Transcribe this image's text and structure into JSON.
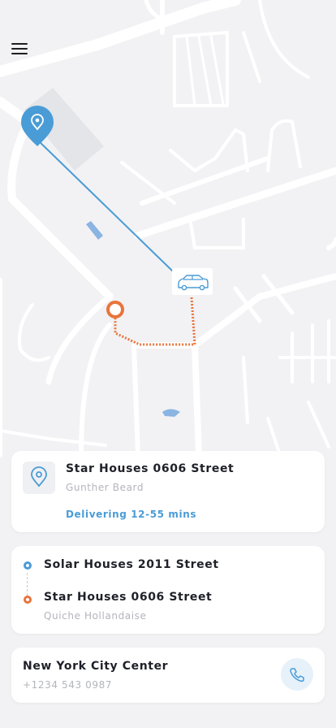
{
  "map": {
    "origin_icon": "location-pin-icon",
    "vehicle_icon": "car-icon",
    "destination_icon": "destination-ring-icon",
    "colors": {
      "background": "#f2f2f4",
      "road": "#ffffff",
      "water": "#8ab4e2",
      "park": "#e4e5e8",
      "route_blue": "#4a9cd6",
      "route_orange": "#e8743b"
    }
  },
  "header": {
    "menu_icon": "hamburger-menu-icon"
  },
  "delivery_card": {
    "icon": "location-pin-icon",
    "address": "Star Houses 0606 Street",
    "person": "Gunther Beard",
    "eta": "Delivering 12-55 mins"
  },
  "route_card": {
    "from": {
      "address": "Solar Houses 2011 Street",
      "color": "#4a9cd6"
    },
    "to": {
      "address": "Star Houses 0606 Street",
      "sub": "Quiche Hollandaise",
      "color": "#e8743b"
    }
  },
  "contact_card": {
    "name": "New York City Center",
    "phone": "+1234 543 0987",
    "call_icon": "phone-icon"
  }
}
